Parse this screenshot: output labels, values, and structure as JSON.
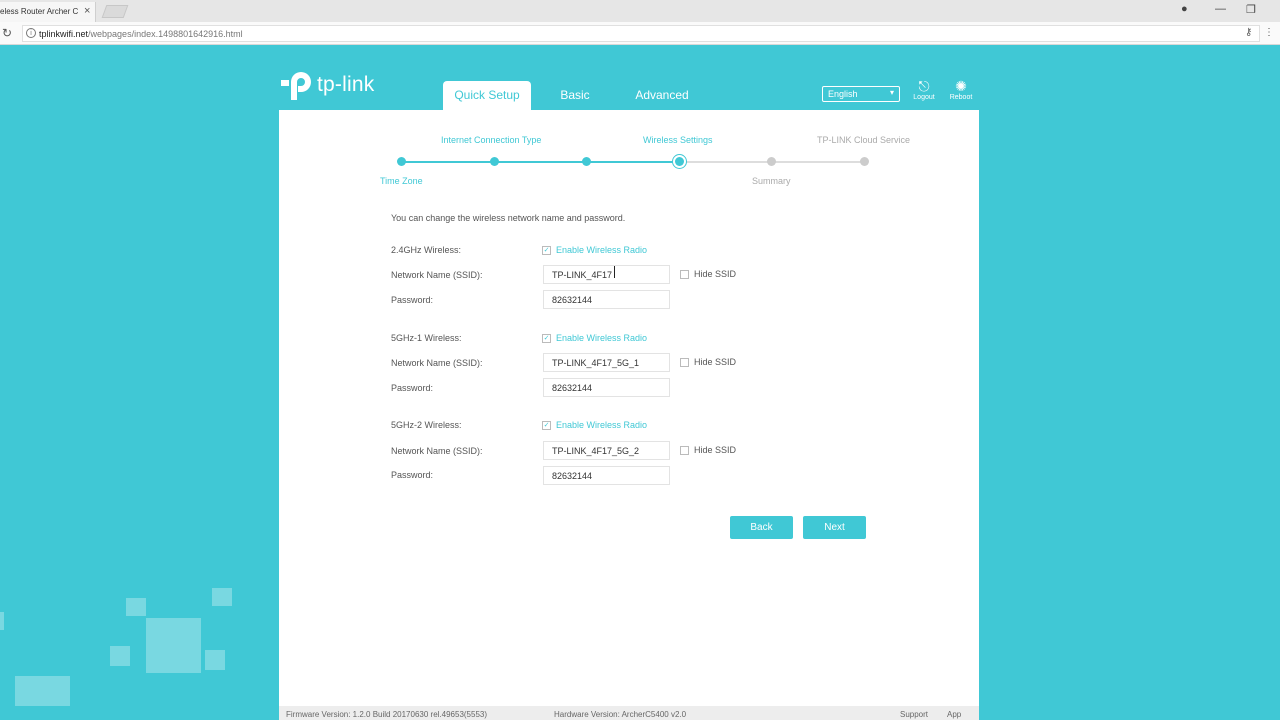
{
  "browser": {
    "tab_title": "eless Router Archer C",
    "tab_close": "×",
    "url_host": "tplinkwifi.net",
    "url_path": "/webpages/index.1498801642916.html",
    "reload_icon": "↻",
    "info_icon": "i",
    "win_user_icon": "●",
    "win_min": "—",
    "win_restore": "❐",
    "key_icon": "⚷",
    "menu_icon": "⋮"
  },
  "header": {
    "logo_text": "tp-link",
    "nav": [
      "Quick Setup",
      "Basic",
      "Advanced"
    ],
    "language": "English",
    "logout_label": "Logout",
    "reboot_label": "Reboot"
  },
  "progress": {
    "top_labels": [
      "Internet Connection Type",
      "Wireless Settings",
      "TP-LINK Cloud Service"
    ],
    "bottom_labels": [
      "Time Zone",
      "Summary"
    ]
  },
  "form": {
    "intro": "You can change the wireless network name and password.",
    "ssid_label": "Network Name (SSID):",
    "password_label": "Password:",
    "enable_label": "Enable Wireless Radio",
    "hide_label": "Hide SSID",
    "bands": [
      {
        "name": "2.4GHz Wireless:",
        "ssid": "TP-LINK_4F17",
        "password": "82632144",
        "enabled": true,
        "hidden": false
      },
      {
        "name": "5GHz-1 Wireless:",
        "ssid": "TP-LINK_4F17_5G_1",
        "password": "82632144",
        "enabled": true,
        "hidden": false
      },
      {
        "name": "5GHz-2 Wireless:",
        "ssid": "TP-LINK_4F17_5G_2",
        "password": "82632144",
        "enabled": true,
        "hidden": false
      }
    ],
    "back_label": "Back",
    "next_label": "Next"
  },
  "footer": {
    "firmware": "Firmware Version: 1.2.0 Build 20170630 rel.49653(5553)",
    "hardware": "Hardware Version: ArcherC5400 v2.0",
    "support": "Support",
    "app": "App"
  },
  "colors": {
    "accent": "#40c8d5"
  }
}
